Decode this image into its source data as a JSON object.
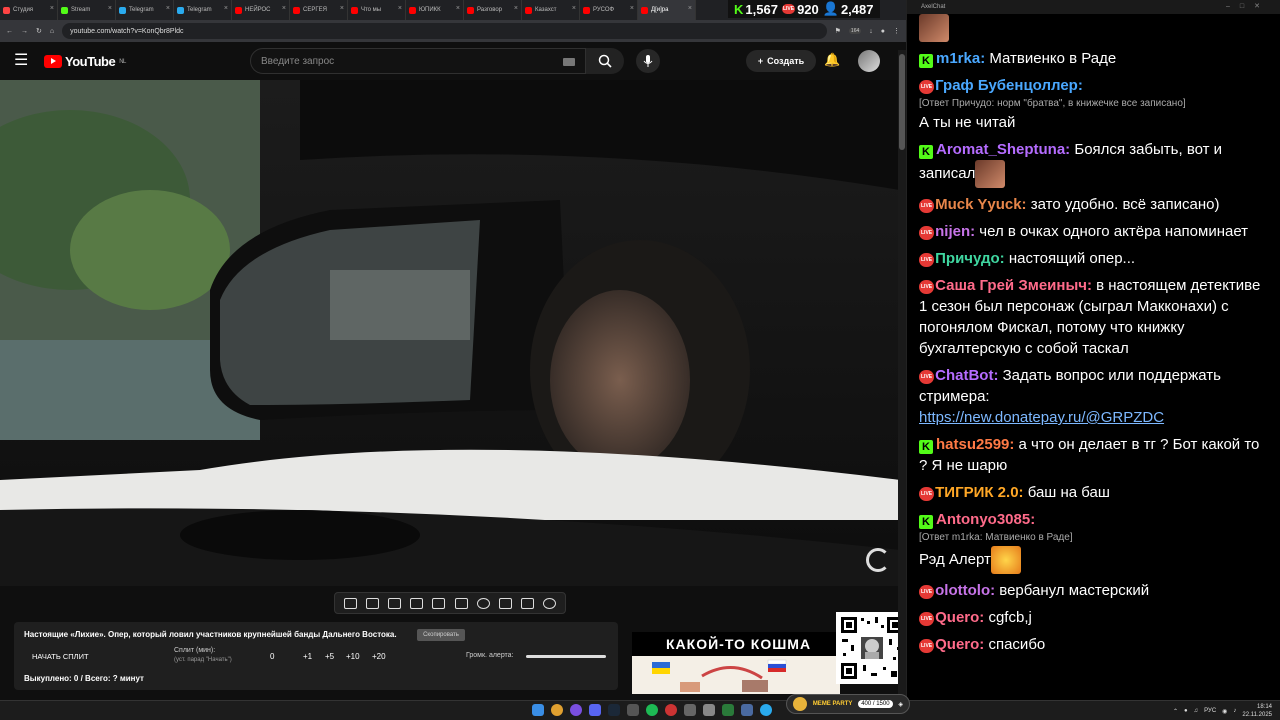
{
  "tabs": [
    {
      "label": "Студия",
      "color": "#ff4444",
      "active": false
    },
    {
      "label": "Stream",
      "color": "#53fc18",
      "active": false
    },
    {
      "label": "Telegram",
      "color": "#2aabee",
      "active": false
    },
    {
      "label": "Telegram",
      "color": "#2aabee",
      "active": false
    },
    {
      "label": "НЕЙРОС",
      "color": "#ff0000",
      "active": false
    },
    {
      "label": "СЕРГЕЯ",
      "color": "#ff0000",
      "active": false
    },
    {
      "label": "Что мы",
      "color": "#ff0000",
      "active": false
    },
    {
      "label": "ЮПИКК",
      "color": "#ff0000",
      "active": false
    },
    {
      "label": "Разговор",
      "color": "#ff0000",
      "active": false
    },
    {
      "label": "Казахст",
      "color": "#ff0000",
      "active": false
    },
    {
      "label": "РУСОФ",
      "color": "#ff0000",
      "active": false
    },
    {
      "label": "Д[и]ра",
      "color": "#ff0000",
      "active": true
    }
  ],
  "counters": {
    "kick": "1,567",
    "live": "920",
    "viewers": "2,487"
  },
  "browser": {
    "url": "youtube.com/watch?v=KonQbr8Pldc",
    "ext_badge": "164"
  },
  "youtube": {
    "logo_text": "YouTube",
    "region": "NL",
    "search_placeholder": "Введите запрос",
    "create_label": "Создать"
  },
  "panel": {
    "title": "Настоящие «Лихие». Опер, который ловил участников крупнейшей банды Дальнего Востока.",
    "copy_label": "Скопировать",
    "split_button": "НАЧАТЬ СПЛИТ",
    "split_label": "Сплит (мин):",
    "split_hint": "(уст. парад \"Начать\")",
    "split_value": "0",
    "increments": [
      "+1",
      "+5",
      "+10",
      "+20"
    ],
    "alert_label": "Громк. алерта:",
    "alert_level": 1.0,
    "stats": "Выкуплено: 0 / Всего: ? минут"
  },
  "banner": {
    "text": "КАКОЙ-ТО КОШМА"
  },
  "now_playing": {
    "title": "MEME PARTY",
    "progress": "400 / 1500"
  },
  "tray": {
    "lang": "РУС",
    "time": "18:14",
    "date": "22.11.2025"
  },
  "chat": {
    "window_title": "AxelChat",
    "messages": [
      {
        "platform": "emote-only",
        "user": "",
        "user_color": "#ffffff",
        "reply": "",
        "text": ""
      },
      {
        "platform": "kick",
        "user": "m1rka:",
        "user_color": "#4aa8ff",
        "reply": "",
        "text": "Матвиенко в Раде"
      },
      {
        "platform": "live",
        "user": "Граф Бубенцоллер:",
        "user_color": "#4aa8ff",
        "reply": "[Ответ Причудо: норм \"братва\", в книжечке все записано]",
        "text": "А ты не читай"
      },
      {
        "platform": "kick",
        "user": "Aromat_Sheptuna:",
        "user_color": "#b56cff",
        "reply": "",
        "text": "Боялся забыть, вот и записал"
      },
      {
        "platform": "live",
        "user": "Muck Yyuck:",
        "user_color": "#e8864a",
        "reply": "",
        "text": "зато удобно. всё записано)"
      },
      {
        "platform": "live",
        "user": "nijen:",
        "user_color": "#c774e8",
        "reply": "",
        "text": "чел в очках одного актёра напоминает"
      },
      {
        "platform": "live",
        "user": "Причудо:",
        "user_color": "#3fd6a0",
        "reply": "",
        "text": "настоящий опер..."
      },
      {
        "platform": "live",
        "user": "Саша Грей Змеиныч:",
        "user_color": "#ff6b8a",
        "reply": "",
        "text": "в настоящем детективе 1 сезон был персонаж (сыграл Макконахи) с погонялом Фискал, потому что книжку бухгалтерскую с собой таскал"
      },
      {
        "platform": "live",
        "user": "ChatBot:",
        "user_color": "#b56cff",
        "reply": "",
        "text": "Задать вопрос или поддержать стримера:",
        "link": "https://new.donatepay.ru/@GRPZDC"
      },
      {
        "platform": "kick",
        "user": "hatsu2599:",
        "user_color": "#ff7a45",
        "reply": "",
        "text": "а что он делает в тг ? Бот какой то ? Я не шарю"
      },
      {
        "platform": "live",
        "user": "ТИГРИК 2.0:",
        "user_color": "#ffa726",
        "reply": "",
        "text": "баш на баш"
      },
      {
        "platform": "kick",
        "user": "Antonyo3085:",
        "user_color": "#ff6b8a",
        "reply": "[Ответ m1rka: Матвиенко в Раде]",
        "text": "Рэд Алерт"
      },
      {
        "platform": "live",
        "user": "olottolo:",
        "user_color": "#c774e8",
        "reply": "",
        "text": "вербанул мастерский"
      },
      {
        "platform": "live",
        "user": "Quero:",
        "user_color": "#ff6b8a",
        "reply": "",
        "text": "cgfcb,j"
      },
      {
        "platform": "live",
        "user": "Quero:",
        "user_color": "#ff6b8a",
        "reply": "",
        "text": "спасибо"
      }
    ]
  }
}
